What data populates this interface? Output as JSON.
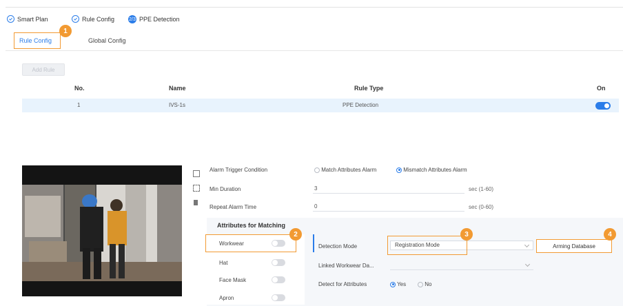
{
  "breadcrumb": {
    "steps": [
      {
        "label": "Smart Plan",
        "state": "done"
      },
      {
        "label": "Rule Config",
        "state": "done"
      },
      {
        "label": "PPE Detection",
        "state": "current",
        "badge": "2/3"
      }
    ]
  },
  "tabs": [
    {
      "label": "Rule Config",
      "active": true
    },
    {
      "label": "Global Config",
      "active": false
    }
  ],
  "toolbar": {
    "add_label": "Add Rule"
  },
  "table": {
    "headers": {
      "no": "No.",
      "name": "Name",
      "rule_type": "Rule Type",
      "on": "On"
    },
    "rows": [
      {
        "no": "1",
        "name": "IVS-1s",
        "rule_type": "PPE Detection",
        "on": true
      }
    ]
  },
  "callouts": [
    "1",
    "2",
    "3",
    "4"
  ],
  "form": {
    "alarm_trigger_label": "Alarm Trigger Condition",
    "alarm_options": [
      "Match Attributes Alarm",
      "Mismatch Attributes Alarm"
    ],
    "alarm_selected": "Mismatch Attributes Alarm",
    "min_duration_label": "Min Duration",
    "min_duration_value": "3",
    "min_duration_unit": "sec (1-60)",
    "repeat_alarm_label": "Repeat Alarm Time",
    "repeat_alarm_value": "0",
    "repeat_alarm_unit": "sec (0-60)"
  },
  "attributes": {
    "title": "Attributes for Matching",
    "items": [
      {
        "label": "Workwear",
        "on": false
      },
      {
        "label": "Hat",
        "on": false
      },
      {
        "label": "Face Mask",
        "on": false
      },
      {
        "label": "Apron",
        "on": false
      }
    ],
    "detection_mode_label": "Detection Mode",
    "detection_mode_value": "Registration Mode",
    "arming_database_label": "Arming Database",
    "linked_workwear_label": "Linked Workwear Da...",
    "detect_for_attributes_label": "Detect for Attributes",
    "detect_options": [
      "Yes",
      "No"
    ],
    "detect_selected": "Yes"
  },
  "colors": {
    "accent": "#2b7de9",
    "callout": "#f29a32",
    "selected_row": "#e8f3fd"
  }
}
